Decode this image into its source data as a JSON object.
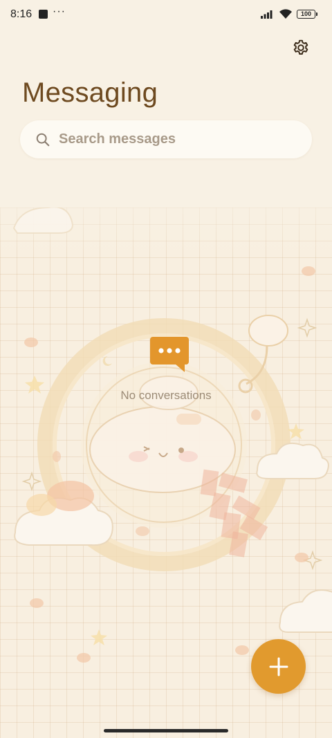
{
  "status_bar": {
    "time": "8:16",
    "more": "···",
    "battery": "100"
  },
  "header": {
    "title": "Messaging",
    "settings_icon": "gear-icon"
  },
  "search": {
    "placeholder": "Search messages",
    "icon": "search-icon"
  },
  "empty_state": {
    "icon": "chat-bubble-icon",
    "text": "No conversations"
  },
  "fab": {
    "icon": "plus-icon",
    "color": "#e19a2e"
  },
  "colors": {
    "background": "#f8f1e4",
    "title": "#6e4a20",
    "accent": "#e19a2e"
  }
}
